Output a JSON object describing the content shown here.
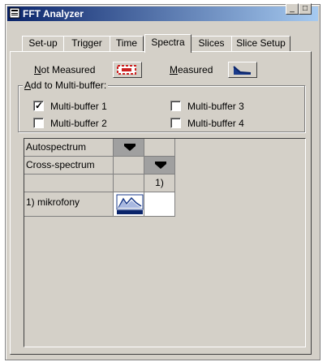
{
  "window": {
    "title": "FFT Analyzer",
    "controls": {
      "minimize": "_",
      "maximize": "□",
      "close": "×"
    }
  },
  "tabs": [
    {
      "label": "Set-up"
    },
    {
      "label": "Trigger"
    },
    {
      "label": "Time"
    },
    {
      "label": "Spectra",
      "active": true
    },
    {
      "label": "Slices"
    },
    {
      "label": "Slice Setup"
    }
  ],
  "legend": {
    "not_measured_label": "Not Measured",
    "measured_label": "Measured"
  },
  "multibuffer": {
    "group_title": "Add to Multi-buffer:",
    "items": [
      {
        "label": "Multi-buffer 1",
        "checked": true
      },
      {
        "label": "Multi-buffer 2",
        "checked": false
      },
      {
        "label": "Multi-buffer 3",
        "checked": false
      },
      {
        "label": "Multi-buffer 4",
        "checked": false
      }
    ]
  },
  "grid": {
    "rows": [
      "Autospectrum",
      "Cross-spectrum",
      "",
      "1) mikrofony"
    ],
    "column_header": "1)"
  },
  "colors": {
    "face": "#d4d0c8",
    "titlebar_start": "#0a246a",
    "titlebar_end": "#a6caf0",
    "measured_blue": "#1a3a8a",
    "not_measured_red": "#cc2020"
  }
}
